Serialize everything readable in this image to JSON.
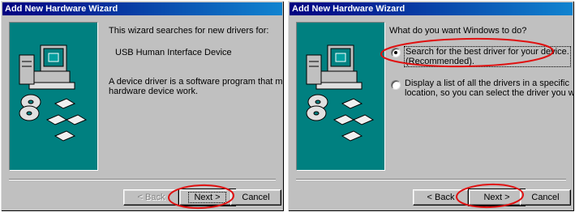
{
  "left_dialog": {
    "title": "Add New Hardware Wizard",
    "intro": "This wizard searches for new drivers for:",
    "device": "USB Human Interface Device",
    "description_line1": "A device driver is a software program that makes a",
    "description_line2": "hardware device work.",
    "buttons": {
      "back": "< Back",
      "next": "Next >",
      "cancel": "Cancel"
    }
  },
  "right_dialog": {
    "title": "Add New Hardware Wizard",
    "question": "What do you want Windows to do?",
    "options": [
      {
        "line1": "Search for the best driver for your device.",
        "line2": "(Recommended).",
        "selected": true
      },
      {
        "line1": "Display a list of all the drivers in a specific",
        "line2": "location, so you can select the driver you want.",
        "selected": false
      }
    ],
    "buttons": {
      "back": "< Back",
      "next": "Next >",
      "cancel": "Cancel"
    }
  },
  "colors": {
    "title_gradient_start": "#000080",
    "title_gradient_end": "#1084d0",
    "face": "#c0c0c0",
    "art_background": "#008080",
    "annotation": "#e01010"
  },
  "icons": [
    "computer-icon",
    "cd-disc-icon",
    "floppy-disk-icon"
  ]
}
